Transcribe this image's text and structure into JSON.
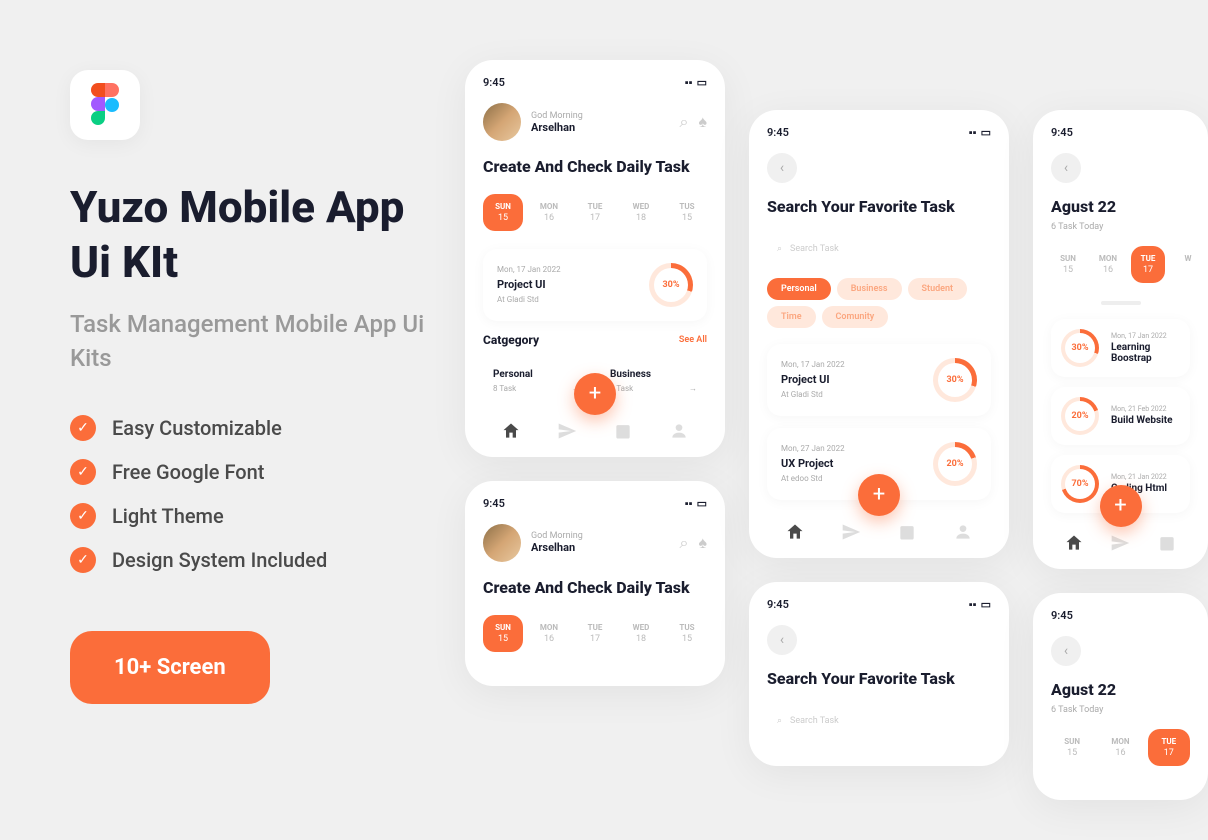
{
  "left": {
    "title": "Yuzo Mobile App Ui KIt",
    "subtitle": "Task Management Mobile App Ui Kits",
    "features": [
      "Easy Customizable",
      "Free Google Font",
      "Light Theme",
      "Design System Included"
    ],
    "cta": "10+ Screen"
  },
  "status": {
    "time": "9:45"
  },
  "home": {
    "greeting": "God Morning",
    "username": "Arselhan",
    "heading": "Create And Check Daily Task",
    "days": [
      {
        "n": "SUN",
        "d": "15",
        "active": true
      },
      {
        "n": "MON",
        "d": "16"
      },
      {
        "n": "TUE",
        "d": "17"
      },
      {
        "n": "WED",
        "d": "18"
      },
      {
        "n": "TUS",
        "d": "15"
      }
    ],
    "task": {
      "date": "Mon, 17 Jan 2022",
      "name": "Project UI",
      "loc": "At Gladi Std",
      "pct": "30%"
    },
    "catTitle": "Catgegory",
    "seeAll": "See All",
    "cats": [
      {
        "n": "Personal",
        "c": "8 Task"
      },
      {
        "n": "Business",
        "c": "6 Task"
      }
    ]
  },
  "search": {
    "heading": "Search Your Favorite Task",
    "placeholder": "Search Task",
    "chips": [
      {
        "t": "Personal",
        "a": true
      },
      {
        "t": "Business"
      },
      {
        "t": "Student"
      },
      {
        "t": "Time"
      },
      {
        "t": "Comunity"
      }
    ],
    "tasks": [
      {
        "date": "Mon, 17 Jan 2022",
        "name": "Project UI",
        "loc": "At Gladi Std",
        "pct": "30%"
      },
      {
        "date": "Mon, 27 Jan 2022",
        "name": "UX Project",
        "loc": "At edoo Std",
        "pct": "20%"
      }
    ]
  },
  "cal": {
    "title": "Agust 22",
    "sub": "6 Task Today",
    "days": [
      {
        "n": "SUN",
        "d": "15"
      },
      {
        "n": "MON",
        "d": "16"
      },
      {
        "n": "TUE",
        "d": "17",
        "active": true
      },
      {
        "n": "W",
        "d": ""
      }
    ],
    "tasks": [
      {
        "date": "Mon, 17 Jan 2022",
        "name": "Learning Boostrap",
        "pct": "30%"
      },
      {
        "date": "Mon, 21 Feb 2022",
        "name": "Build Website",
        "pct": "20%"
      },
      {
        "date": "Mon, 21 Jan 2022",
        "name": "Coding Html",
        "pct": "70%"
      }
    ]
  }
}
